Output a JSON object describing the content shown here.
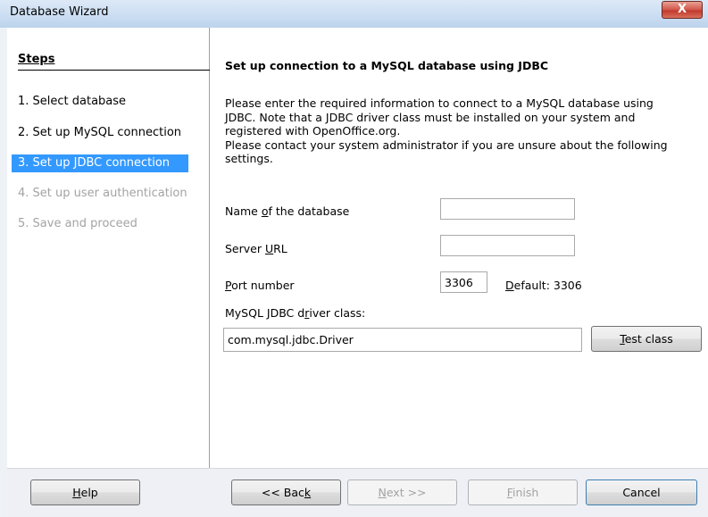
{
  "window": {
    "title": "Database Wizard",
    "close_label": "X"
  },
  "steps": {
    "heading": "Steps",
    "items": [
      {
        "label": "1. Select database",
        "state": "normal"
      },
      {
        "label": "2. Set up MySQL connection",
        "state": "normal"
      },
      {
        "label": "3. Set up JDBC connection",
        "state": "active"
      },
      {
        "label": "4. Set up user authentication",
        "state": "disabled"
      },
      {
        "label": "5. Save and proceed",
        "state": "disabled"
      }
    ]
  },
  "page": {
    "title": "Set up connection to a MySQL database using JDBC",
    "description_lines": [
      "Please enter the required information to connect to a MySQL database using",
      "JDBC. Note that a JDBC driver class must be installed on your system and",
      "registered with OpenOffice.org.",
      "Please contact your system administrator if you are unsure about the following",
      "settings."
    ]
  },
  "form": {
    "database_name": {
      "label_pre": "Name ",
      "label_key": "o",
      "label_post": "f the database",
      "value": ""
    },
    "server_url": {
      "label_pre": "Server ",
      "label_key": "U",
      "label_post": "RL",
      "value": ""
    },
    "port": {
      "label_pre": "",
      "label_key": "P",
      "label_post": "ort number",
      "value": "3306"
    },
    "port_default": {
      "label_pre": "",
      "label_key": "D",
      "label_post": "efault: 3306"
    },
    "driver_class": {
      "label_pre": "MySQL JDBC d",
      "label_key": "r",
      "label_post": "iver class:",
      "value": "com.mysql.jdbc.Driver"
    },
    "test_class_button": {
      "label_pre": "",
      "label_key": "T",
      "label_post": "est class"
    }
  },
  "buttons": {
    "help": {
      "label_pre": "",
      "label_key": "H",
      "label_post": "elp"
    },
    "back": {
      "label_pre": "<< Bac",
      "label_key": "k",
      "label_post": ""
    },
    "next": {
      "label_pre": "",
      "label_key": "N",
      "label_post": "ext >>"
    },
    "finish": {
      "label_pre": "",
      "label_key": "F",
      "label_post": "inish"
    },
    "cancel": {
      "label": "Cancel"
    }
  }
}
